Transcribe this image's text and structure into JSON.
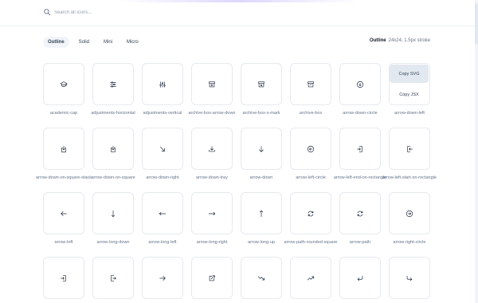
{
  "search": {
    "placeholder": "Search all icons..."
  },
  "tabs": [
    {
      "label": "Outline",
      "active": true
    },
    {
      "label": "Solid",
      "active": false
    },
    {
      "label": "Mini",
      "active": false
    },
    {
      "label": "Micro",
      "active": false
    }
  ],
  "meta": {
    "style_name": "Outline",
    "description": "24x24, 1.5px stroke"
  },
  "popover": {
    "copy_svg": "Copy SVG",
    "copy_jsx": "Copy JSX"
  },
  "icons": [
    {
      "name": "academic-cap",
      "icon": "academic-cap-icon"
    },
    {
      "name": "adjustments-horizontal",
      "icon": "adjustments-horizontal-icon"
    },
    {
      "name": "adjustments-vertical",
      "icon": "adjustments-vertical-icon"
    },
    {
      "name": "archive-box-arrow-down",
      "icon": "archive-box-arrow-down-icon"
    },
    {
      "name": "archive-box-x-mark",
      "icon": "archive-box-x-mark-icon"
    },
    {
      "name": "archive-box",
      "icon": "archive-box-icon"
    },
    {
      "name": "arrow-down-circle",
      "icon": "arrow-down-circle-icon"
    },
    {
      "name": "arrow-down-left",
      "icon": "arrow-down-left-icon"
    },
    {
      "name": "arrow-down-on-square-stack",
      "icon": "arrow-down-on-square-stack-icon"
    },
    {
      "name": "arrow-down-on-square",
      "icon": "arrow-down-on-square-icon"
    },
    {
      "name": "arrow-down-right",
      "icon": "arrow-down-right-icon"
    },
    {
      "name": "arrow-down-tray",
      "icon": "arrow-down-tray-icon"
    },
    {
      "name": "arrow-down",
      "icon": "arrow-down-icon"
    },
    {
      "name": "arrow-left-circle",
      "icon": "arrow-left-circle-icon"
    },
    {
      "name": "arrow-left-end-on-rectangle",
      "icon": "arrow-left-end-on-rectangle-icon"
    },
    {
      "name": "arrow-left-start-on-rectangle",
      "icon": "arrow-left-start-on-rectangle-icon"
    },
    {
      "name": "arrow-left",
      "icon": "arrow-left-icon"
    },
    {
      "name": "arrow-long-down",
      "icon": "arrow-long-down-icon"
    },
    {
      "name": "arrow-long-left",
      "icon": "arrow-long-left-icon"
    },
    {
      "name": "arrow-long-right",
      "icon": "arrow-long-right-icon"
    },
    {
      "name": "arrow-long-up",
      "icon": "arrow-long-up-icon"
    },
    {
      "name": "arrow-path-rounded-square",
      "icon": "arrow-path-rounded-square-icon"
    },
    {
      "name": "arrow-path",
      "icon": "arrow-path-icon"
    },
    {
      "name": "arrow-right-circle",
      "icon": "arrow-right-circle-icon"
    },
    {
      "name": "",
      "icon": "arrow-right-end-on-rectangle-icon"
    },
    {
      "name": "",
      "icon": "arrow-right-start-on-rectangle-icon"
    },
    {
      "name": "",
      "icon": "arrow-right-icon"
    },
    {
      "name": "",
      "icon": "arrow-top-right-on-square-icon"
    },
    {
      "name": "",
      "icon": "arrow-trending-down-icon"
    },
    {
      "name": "",
      "icon": "arrow-trending-up-icon"
    },
    {
      "name": "",
      "icon": "arrow-turn-down-left-icon"
    },
    {
      "name": "",
      "icon": "arrow-turn-down-right-icon"
    }
  ]
}
